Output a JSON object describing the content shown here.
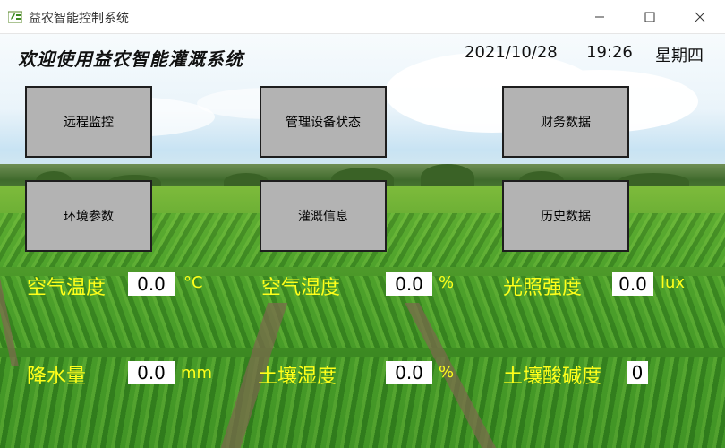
{
  "window": {
    "title": "益农智能控制系统",
    "icon": "app-logo-icon",
    "controls": [
      "minimize-icon",
      "maximize-icon",
      "close-icon"
    ]
  },
  "header": {
    "welcome": "欢迎使用益农智能灌溉系统",
    "date": "2021/10/28",
    "time": "19:26",
    "weekday": "星期四"
  },
  "buttons": {
    "remote_monitor": "远程监控",
    "device_status": "管理设备状态",
    "finance_data": "财务数据",
    "env_params": "环境参数",
    "irrigation_info": "灌溉信息",
    "history_data": "历史数据"
  },
  "readings": {
    "air_temp": {
      "label": "空气温度",
      "value": "0.0",
      "unit": "°C"
    },
    "air_humidity": {
      "label": "空气湿度",
      "value": "0.0",
      "unit": "%"
    },
    "light": {
      "label": "光照强度",
      "value": "0.0",
      "unit": "lux"
    },
    "rainfall": {
      "label": "降水量",
      "value": "0.0",
      "unit": "mm"
    },
    "soil_humidity": {
      "label": "土壤湿度",
      "value": "0.0",
      "unit": "%"
    },
    "soil_ph": {
      "label": "土壤酸碱度",
      "value": "0"
    }
  },
  "colors": {
    "label_yellow": "#ffff1a",
    "button_gray": "#b3b3b3",
    "button_border": "#1e1e1e"
  }
}
